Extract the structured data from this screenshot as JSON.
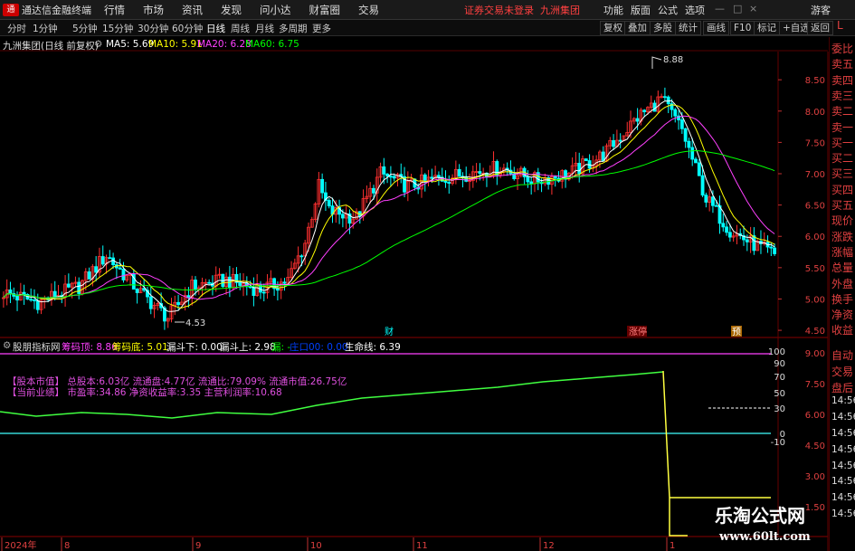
{
  "app": {
    "title": "通达信金融终端",
    "menu": [
      "行情",
      "市场",
      "资讯",
      "发现",
      "问小达",
      "财富圈",
      "交易"
    ],
    "notice": "证券交易未登录",
    "company": "九洲集团",
    "right_menu": [
      "功能",
      "版面",
      "公式",
      "选项"
    ],
    "user": "游客"
  },
  "toolbar": {
    "periods": [
      "分时",
      "1分钟",
      "5分钟",
      "15分钟",
      "30分钟",
      "60分钟",
      "日线",
      "周线",
      "月线",
      "多周期",
      "更多"
    ],
    "active_period": "日线",
    "right_buttons": [
      "复权",
      "叠加",
      "多股",
      "统计",
      "画线",
      "F10",
      "标记",
      "+自选",
      "返回"
    ]
  },
  "stock": {
    "title": "九洲集团(日线 前复权)",
    "ma_labels": [
      "MA5: 5.69",
      "MA10: 5.91",
      "MA20: 6.28",
      "MA60: 6.75"
    ],
    "ma_colors": [
      "#ffffff",
      "#ffff00",
      "#ff40ff",
      "#00ff00"
    ],
    "high_label": "8.88",
    "low_label": "4.53",
    "markers": [
      "财",
      "涨停",
      "预"
    ]
  },
  "price_axis": [
    "8.50",
    "8.00",
    "7.50",
    "7.00",
    "6.50",
    "6.00",
    "5.50",
    "5.00",
    "4.50"
  ],
  "indicator": {
    "name": "股朋指标网",
    "labels": [
      {
        "label": "筹码顶: 8.86",
        "color": "#ff40ff"
      },
      {
        "label": "筹码底: 5.01",
        "color": "#ffff00"
      },
      {
        "label": "漏斗下: 0.00",
        "color": "#ffffff"
      },
      {
        "label": "漏斗上: 2.98",
        "color": "#ffffff"
      },
      {
        "label": "漏: -",
        "color": "#00ff00"
      },
      {
        "label": "庄口00: 0.00",
        "color": "#0040ff"
      },
      {
        "label": "生命线: 6.39",
        "color": "#ffffff"
      }
    ],
    "fund_line1": "【股本市值】 总股本:6.03亿 流通盘:4.77亿 流通比:79.09% 流通市值:26.75亿",
    "fund_line2": "【当前业绩】 市盈率:34.86 净资收益率:3.35 主营利润率:10.68",
    "axis_left": [
      "100",
      "90",
      "70",
      "50",
      "30",
      "0",
      "-10"
    ],
    "axis_right": [
      "9.00",
      "7.50",
      "6.00",
      "4.50",
      "3.00",
      "1.50"
    ]
  },
  "right_panel": {
    "items": [
      "委比",
      "卖五",
      "卖四",
      "卖三",
      "卖二",
      "卖一",
      "买一",
      "买二",
      "买三",
      "买四",
      "买五",
      "现价",
      "涨跌",
      "涨幅",
      "总量",
      "外盘",
      "换手",
      "净资",
      "收益"
    ],
    "lower_items": [
      "自动",
      "交易",
      "盘后",
      "14:56",
      "14:56",
      "14:56",
      "14:56",
      "14:56",
      "14:56",
      "14:56",
      "14:56"
    ],
    "tab": "L"
  },
  "date_axis": [
    "2024年",
    "8",
    "9",
    "10",
    "11",
    "12",
    "1"
  ],
  "watermark": {
    "line1": "乐淘公式网",
    "line2": "www.60lt.com"
  }
}
